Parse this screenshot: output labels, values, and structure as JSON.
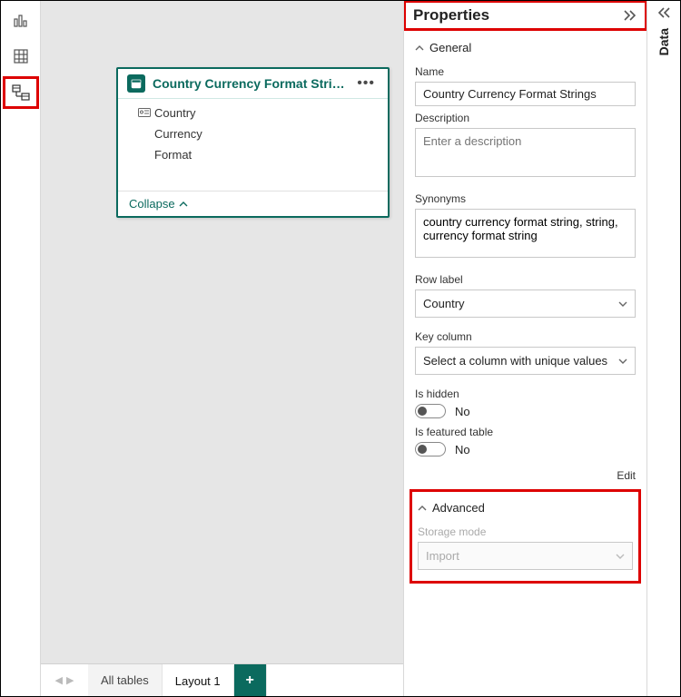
{
  "properties": {
    "panelTitle": "Properties",
    "general": {
      "header": "General",
      "nameLabel": "Name",
      "nameValue": "Country Currency Format Strings",
      "descriptionLabel": "Description",
      "descriptionPlaceholder": "Enter a description",
      "descriptionValue": "",
      "synonymsLabel": "Synonyms",
      "synonymsValue": "country currency format string, string, currency format string",
      "rowLabelLabel": "Row label",
      "rowLabelValue": "Country",
      "keyColumnLabel": "Key column",
      "keyColumnPlaceholder": "Select a column with unique values",
      "isHiddenLabel": "Is hidden",
      "isHiddenValue": "No",
      "isFeaturedLabel": "Is featured table",
      "isFeaturedValue": "No",
      "editLink": "Edit"
    },
    "advanced": {
      "header": "Advanced",
      "storageModeLabel": "Storage mode",
      "storageModeValue": "Import"
    }
  },
  "tableCard": {
    "title": "Country Currency Format Strings",
    "fields": [
      {
        "name": "Country",
        "hasIcon": true
      },
      {
        "name": "Currency",
        "hasIcon": false
      },
      {
        "name": "Format",
        "hasIcon": false
      }
    ],
    "collapseLabel": "Collapse"
  },
  "bottomTabs": {
    "allTables": "All tables",
    "layout1": "Layout 1"
  },
  "dataPane": {
    "label": "Data"
  }
}
